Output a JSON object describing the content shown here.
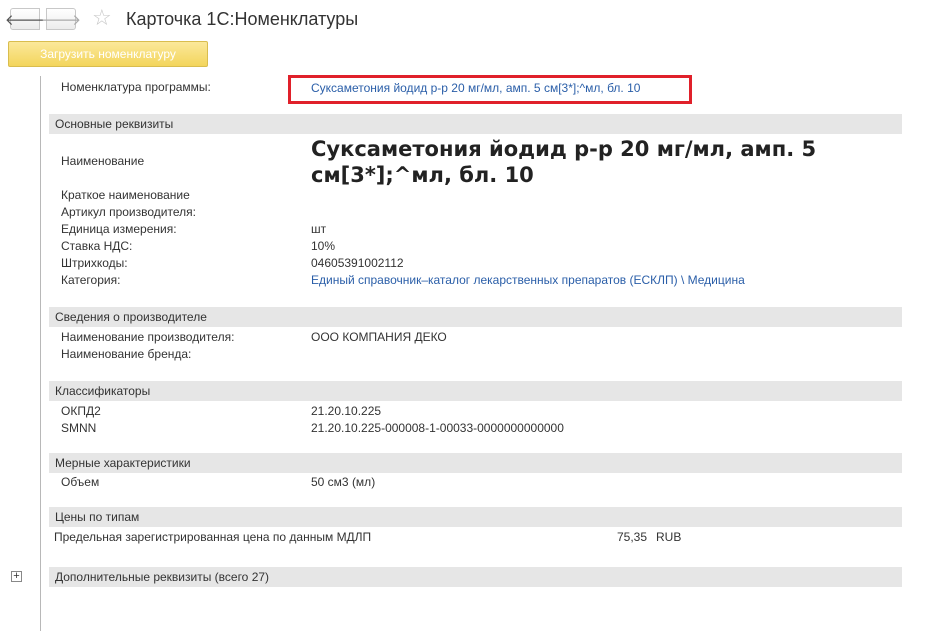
{
  "header": {
    "back_glyph": "🡐",
    "forward_glyph": "🡒",
    "star_glyph": "☆",
    "title": "Карточка 1С:Номенклатуры"
  },
  "toolbar": {
    "load_label": "Загрузить номенклатуру"
  },
  "program": {
    "label": "Номенклатура программы:",
    "value": "Суксаметония йодид р-р 20 мг/мл, амп. 5 см[3*];^мл, бл. 10"
  },
  "main": {
    "section_title": "Основные реквизиты",
    "name_label": "Наименование",
    "name_value": "Суксаметония йодид р-р 20 мг/мл, амп. 5 см[3*];^мл, бл. 10",
    "short_name_label": "Краткое наименование",
    "article_label": "Артикул производителя:",
    "unit_label": "Единица измерения:",
    "unit_value": "шт",
    "vat_label": "Ставка НДС:",
    "vat_value": "10%",
    "barcode_label": "Штрихкоды:",
    "barcode_value": "04605391002112",
    "category_label": "Категория:",
    "category_value": "Единый справочник–каталог лекарственных препаратов (ЕСКЛП) \\ Медицина"
  },
  "manufacturer": {
    "section_title": "Сведения о производителе",
    "name_label": "Наименование производителя:",
    "name_value": "ООО КОМПАНИЯ ДЕКО",
    "brand_label": "Наименование бренда:"
  },
  "classifiers": {
    "section_title": "Классификаторы",
    "okpd_label": "ОКПД2",
    "okpd_value": "21.20.10.225",
    "smnn_label": "SMNN",
    "smnn_value": "21.20.10.225-000008-1-00033-0000000000000"
  },
  "measures": {
    "section_title": "Мерные характеристики",
    "volume_label": "Объем",
    "volume_value": "50 см3 (мл)"
  },
  "prices": {
    "section_title": "Цены по типам",
    "row_label": "Предельная зарегистрированная цена по данным МДЛП",
    "row_amount": "75,35",
    "row_currency": "RUB"
  },
  "extra": {
    "expand_glyph": "+",
    "section_title": "Дополнительные реквизиты (всего 27)"
  },
  "colors": {
    "highlight": "#e0202a",
    "link": "#2a5ea8",
    "load_button": "#f3d55c"
  }
}
